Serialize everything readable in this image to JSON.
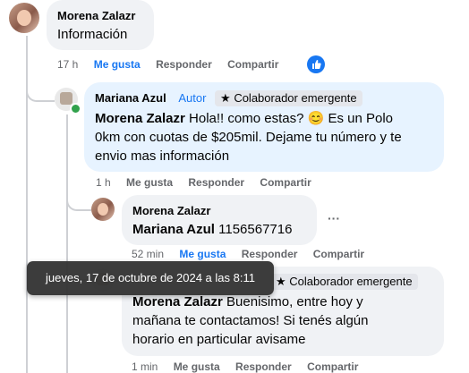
{
  "comment1": {
    "author": "Morena Zalazr",
    "text": "Información",
    "time": "17 h",
    "like": "Me gusta",
    "reply": "Responder",
    "share": "Compartir"
  },
  "comment2": {
    "author": "Mariana Azul",
    "role": "Autor",
    "badge": "Colaborador emergente",
    "mention": "Morena Zalazr",
    "line1_rest": " Hola!! como estas? 😊 Es un Polo",
    "line2": "0km con cuotas de $205mil. Dejame tu número y te",
    "line3": "envio mas información",
    "time": "1 h",
    "like": "Me gusta",
    "reply": "Responder",
    "share": "Compartir"
  },
  "comment3": {
    "author": "Morena Zalazr",
    "mention": "Mariana Azul",
    "text": " 1156567716",
    "more": "···",
    "time": "52 min",
    "like": "Me gusta",
    "reply": "Responder",
    "share": "Compartir"
  },
  "comment4": {
    "badge": "Colaborador emergente",
    "mention": "Morena Zalazr",
    "line1_rest": " Buenisimo, entre hoy y",
    "line2": "mañana te contactamos! Si tenés algún",
    "line3": "horario en particular avisame",
    "time": "1 min",
    "like": "Me gusta",
    "reply": "Responder",
    "share": "Compartir"
  },
  "tooltip": {
    "text": "jueves, 17 de octubre de 2024 a las 8:11"
  },
  "colors": {
    "like_blue": "#1877f2",
    "bubble_gray": "#f0f2f5",
    "reply_blue_bubble": "#e7f3ff",
    "online_green": "#31a24c"
  }
}
